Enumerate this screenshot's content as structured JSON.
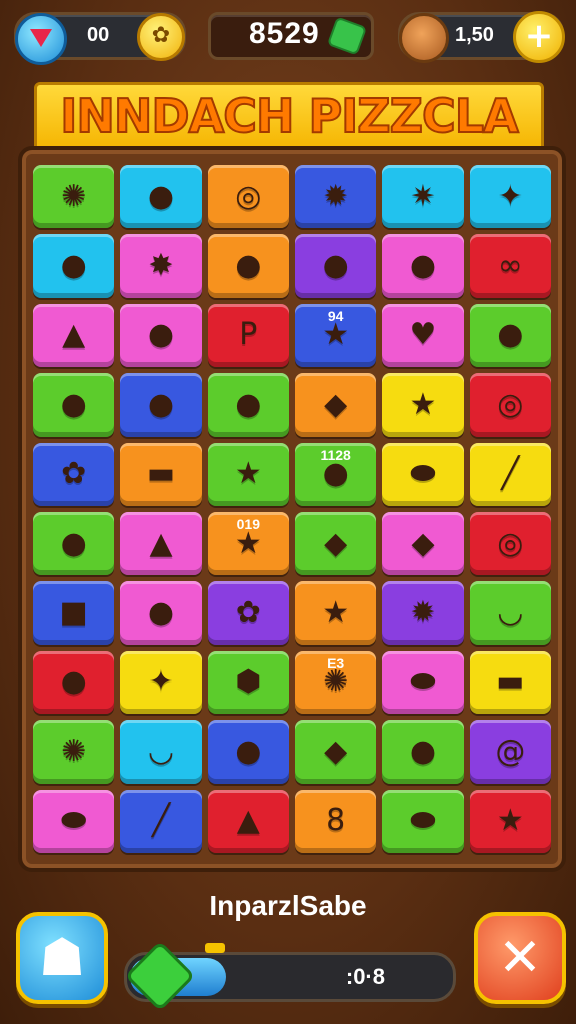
{
  "hud": {
    "gems": "00",
    "score": "8529",
    "coins": "1,50",
    "add_symbol": "+"
  },
  "title": "INNDACH PIZZCLA",
  "colors": {
    "green": "#5ccc2c",
    "cyan": "#22c2ee",
    "orange": "#f7921e",
    "blue": "#3858e0",
    "pink": "#f05ad2",
    "red": "#e0202e",
    "purple": "#8a3ee0",
    "yellow": "#f6dc10"
  },
  "board": {
    "tiles": [
      {
        "color": "green",
        "icon": "crab-icon",
        "glyph": "✺"
      },
      {
        "color": "cyan",
        "icon": "fish-icon",
        "glyph": "●"
      },
      {
        "color": "orange",
        "icon": "ring-icon",
        "glyph": "◎",
        "wide": true
      },
      {
        "color": "blue",
        "icon": "flame-icon",
        "glyph": "✹"
      },
      {
        "color": "cyan",
        "icon": "sun-face-icon",
        "glyph": "✷"
      },
      {
        "color": "cyan",
        "icon": "bug-icon",
        "glyph": "✦"
      },
      {
        "color": "cyan",
        "icon": "cookie-icon",
        "glyph": "●"
      },
      {
        "color": "pink",
        "icon": "virus-icon",
        "glyph": "✸"
      },
      {
        "color": "orange",
        "icon": "frog-icon",
        "glyph": "●",
        "wide": true
      },
      {
        "color": "purple",
        "icon": "ghost-icon",
        "glyph": "●"
      },
      {
        "color": "pink",
        "icon": "fish-icon",
        "glyph": "●"
      },
      {
        "color": "red",
        "icon": "link-icon",
        "glyph": "∞"
      },
      {
        "color": "pink",
        "icon": "hat-icon",
        "glyph": "▲"
      },
      {
        "color": "pink",
        "icon": "bean-icon",
        "glyph": "●"
      },
      {
        "color": "red",
        "icon": "p-icon",
        "glyph": "P"
      },
      {
        "color": "blue",
        "icon": "star-icon",
        "glyph": "★",
        "wide": true,
        "label": "94"
      },
      {
        "color": "pink",
        "icon": "heart-icon",
        "glyph": "♥"
      },
      {
        "color": "green",
        "icon": "blob-icon",
        "glyph": "●"
      },
      {
        "color": "green",
        "icon": "lemon-icon",
        "glyph": "●"
      },
      {
        "color": "blue",
        "icon": "bean-icon",
        "glyph": "●"
      },
      {
        "color": "green",
        "icon": "apple-icon",
        "glyph": "●"
      },
      {
        "color": "orange",
        "icon": "turtle-icon",
        "glyph": "◆",
        "wide": true
      },
      {
        "color": "yellow",
        "icon": "star-face-icon",
        "glyph": "★"
      },
      {
        "color": "red",
        "icon": "donut-icon",
        "glyph": "◎"
      },
      {
        "color": "blue",
        "icon": "flower-icon",
        "glyph": "✿"
      },
      {
        "color": "orange",
        "icon": "ruler-icon",
        "glyph": "▬"
      },
      {
        "color": "green",
        "icon": "arrow-star-icon",
        "glyph": "★"
      },
      {
        "color": "green",
        "icon": "fish-icon",
        "glyph": "●",
        "wide": true,
        "label": "1128"
      },
      {
        "color": "yellow",
        "icon": "leaf-icon",
        "glyph": "⬬"
      },
      {
        "color": "yellow",
        "icon": "crayon-icon",
        "glyph": "╱"
      },
      {
        "color": "green",
        "icon": "monkey-icon",
        "glyph": "●"
      },
      {
        "color": "pink",
        "icon": "rocket-icon",
        "glyph": "▲"
      },
      {
        "color": "orange",
        "icon": "star-icon",
        "glyph": "★",
        "label": "019"
      },
      {
        "color": "green",
        "icon": "gem-icon",
        "glyph": "◆"
      },
      {
        "color": "pink",
        "icon": "kite-icon",
        "glyph": "◆"
      },
      {
        "color": "red",
        "icon": "ring-icon",
        "glyph": "◎"
      },
      {
        "color": "blue",
        "icon": "box-face-icon",
        "glyph": "■"
      },
      {
        "color": "pink",
        "icon": "sausage-icon",
        "glyph": "●"
      },
      {
        "color": "purple",
        "icon": "flower-icon",
        "glyph": "✿"
      },
      {
        "color": "orange",
        "icon": "arrow-star-icon",
        "glyph": "★",
        "wide": true
      },
      {
        "color": "purple",
        "icon": "gear-icon",
        "glyph": "✹"
      },
      {
        "color": "green",
        "icon": "smile-icon",
        "glyph": "◡"
      },
      {
        "color": "red",
        "icon": "bear-icon",
        "glyph": "●"
      },
      {
        "color": "yellow",
        "icon": "sparkle-icon",
        "glyph": "✦"
      },
      {
        "color": "green",
        "icon": "hexagon-icon",
        "glyph": "⬢"
      },
      {
        "color": "orange",
        "icon": "bomb-icon",
        "glyph": "✺",
        "wide": true,
        "label": "E3"
      },
      {
        "color": "pink",
        "icon": "leaf-icon",
        "glyph": "⬬"
      },
      {
        "color": "yellow",
        "icon": "ruler-icon",
        "glyph": "▬"
      },
      {
        "color": "green",
        "icon": "crab-icon",
        "glyph": "✺"
      },
      {
        "color": "cyan",
        "icon": "smile-icon",
        "glyph": "◡"
      },
      {
        "color": "blue",
        "icon": "apple-icon",
        "glyph": "●"
      },
      {
        "color": "green",
        "icon": "turtle-icon",
        "glyph": "◆",
        "wide": true
      },
      {
        "color": "green",
        "icon": "blob-icon",
        "glyph": "●"
      },
      {
        "color": "purple",
        "icon": "spiral-icon",
        "glyph": "@"
      },
      {
        "color": "pink",
        "icon": "feather-icon",
        "glyph": "⬬"
      },
      {
        "color": "blue",
        "icon": "crayon-icon",
        "glyph": "╱"
      },
      {
        "color": "red",
        "icon": "rocket-icon",
        "glyph": "▲"
      },
      {
        "color": "orange",
        "icon": "pretzel-icon",
        "glyph": "8",
        "wide": true
      },
      {
        "color": "green",
        "icon": "leaf-icon",
        "glyph": "⬬"
      },
      {
        "color": "red",
        "icon": "star-icon",
        "glyph": "★"
      }
    ]
  },
  "bottom": {
    "label": "InparzlSabe",
    "progress_text": ":0·8",
    "progress_fraction": 0.3
  }
}
